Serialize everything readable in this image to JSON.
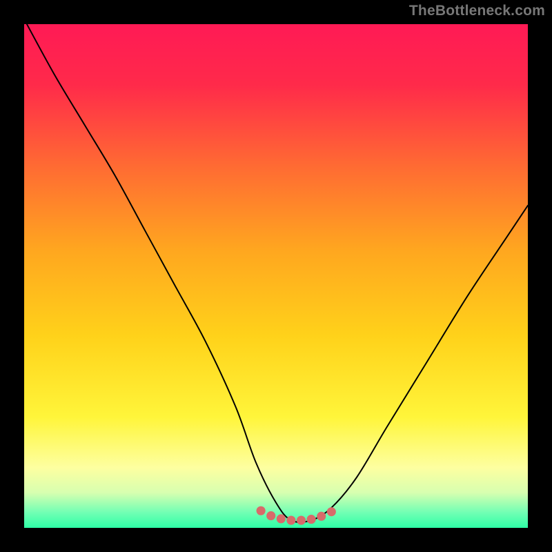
{
  "watermark": "TheBottleneck.com",
  "gradient_stops": [
    {
      "offset": 0.0,
      "color": "#ff1a55"
    },
    {
      "offset": 0.12,
      "color": "#ff2a4a"
    },
    {
      "offset": 0.28,
      "color": "#ff6a33"
    },
    {
      "offset": 0.45,
      "color": "#ffa71f"
    },
    {
      "offset": 0.62,
      "color": "#ffd21a"
    },
    {
      "offset": 0.78,
      "color": "#fff53a"
    },
    {
      "offset": 0.88,
      "color": "#fdffa0"
    },
    {
      "offset": 0.93,
      "color": "#d8ffb0"
    },
    {
      "offset": 0.97,
      "color": "#70ffb4"
    },
    {
      "offset": 1.0,
      "color": "#2effa6"
    }
  ],
  "curve_color": "#000000",
  "marker_color": "#d86a6a",
  "chart_data": {
    "type": "line",
    "title": "",
    "xlabel": "",
    "ylabel": "",
    "xlim": [
      0,
      100
    ],
    "ylim": [
      0,
      100
    ],
    "series": [
      {
        "name": "bottleneck-curve",
        "x": [
          0,
          6,
          12,
          18,
          24,
          30,
          36,
          42,
          46,
          50,
          53,
          57,
          61,
          66,
          72,
          80,
          88,
          96,
          100
        ],
        "y": [
          101,
          90,
          80,
          70,
          59,
          48,
          37,
          24,
          13,
          5,
          1.5,
          1.5,
          4,
          10,
          20,
          33,
          46,
          58,
          64
        ]
      },
      {
        "name": "minimum-markers",
        "x": [
          47,
          49,
          51,
          53,
          55,
          57,
          59,
          61
        ],
        "y": [
          3.4,
          2.4,
          1.8,
          1.5,
          1.5,
          1.7,
          2.3,
          3.2
        ]
      }
    ],
    "annotations": []
  }
}
